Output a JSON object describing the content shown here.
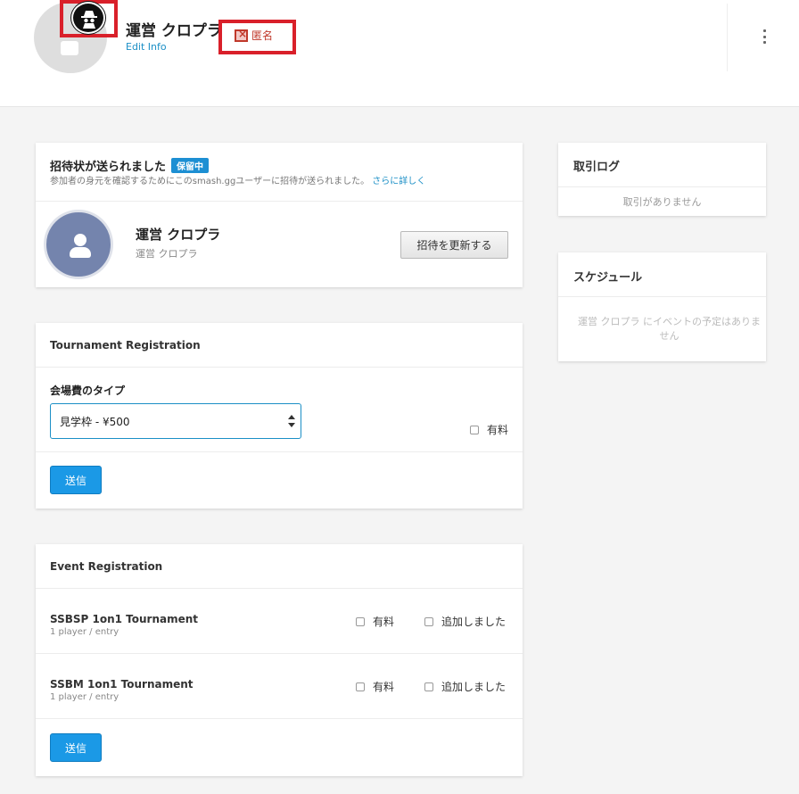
{
  "header": {
    "user_name": "運営 クロプラ",
    "edit_info": "Edit Info",
    "anonymous_label": "匿名"
  },
  "invite": {
    "title": "招待状が送られました",
    "status_badge": "保留中",
    "description": "参加者の身元を確認するためにこのsmash.ggユーザーに招待が送られました。",
    "learn_more": "さらに詳しく",
    "name": "運営 クロプラ",
    "sub_name": "運営 クロプラ",
    "refresh_button": "招待を更新する"
  },
  "tournament_registration": {
    "title": "Tournament Registration",
    "fee_type_label": "会場費のタイプ",
    "fee_type_value": "見学枠 - ¥500",
    "paid_label": "有料",
    "submit_button": "送信"
  },
  "event_registration": {
    "title": "Event Registration",
    "events": [
      {
        "name": "SSBSP 1on1 Tournament",
        "sub": "1 player / entry",
        "paid_label": "有料",
        "added_label": "追加しました"
      },
      {
        "name": "SSBM 1on1 Tournament",
        "sub": "1 player / entry",
        "paid_label": "有料",
        "added_label": "追加しました"
      }
    ],
    "submit_button": "送信"
  },
  "transaction_log": {
    "title": "取引ログ",
    "empty": "取引がありません"
  },
  "schedule": {
    "title": "スケジュール",
    "empty": "運営 クロプラ にイベントの予定はありません"
  },
  "colors": {
    "accent": "#1b99e6",
    "highlight_box": "#d9202a",
    "avatar": "#7484ad"
  }
}
